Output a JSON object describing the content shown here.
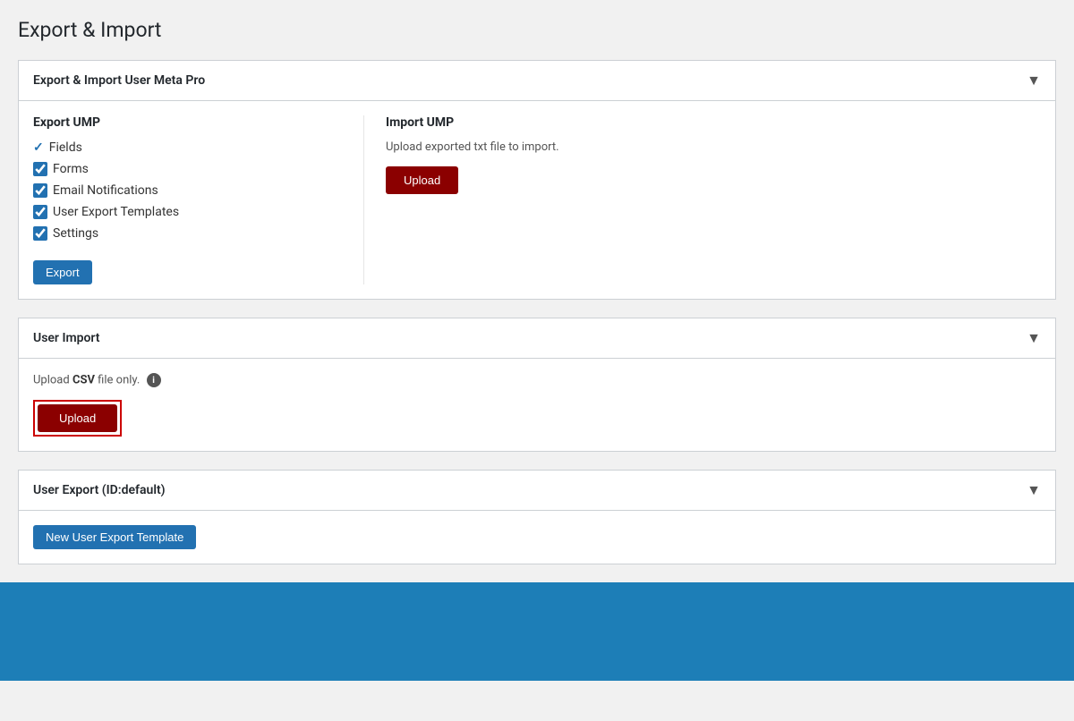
{
  "page": {
    "title": "Export & Import"
  },
  "sections": {
    "export_import_ump": {
      "header": "Export & Import User Meta Pro",
      "export": {
        "col_title": "Export UMP",
        "fields_label": "Fields",
        "checkboxes": [
          {
            "id": "forms",
            "label": "Forms",
            "checked": true
          },
          {
            "id": "email_notifications",
            "label": "Email Notifications",
            "checked": true
          },
          {
            "id": "user_export_templates",
            "label": "User Export Templates",
            "checked": true
          },
          {
            "id": "settings",
            "label": "Settings",
            "checked": true
          }
        ],
        "export_btn_label": "Export"
      },
      "import": {
        "col_title": "Import UMP",
        "description": "Upload exported txt file to import.",
        "upload_btn_label": "Upload"
      }
    },
    "user_import": {
      "header": "User Import",
      "csv_note_prefix": "Upload ",
      "csv_note_bold": "CSV",
      "csv_note_suffix": " file only.",
      "info_tooltip": "i",
      "upload_btn_label": "Upload"
    },
    "user_export": {
      "header": "User Export (ID:default)",
      "new_template_btn_label": "New User Export Template"
    }
  },
  "footer": {
    "bg_color": "#1d7eb7"
  }
}
